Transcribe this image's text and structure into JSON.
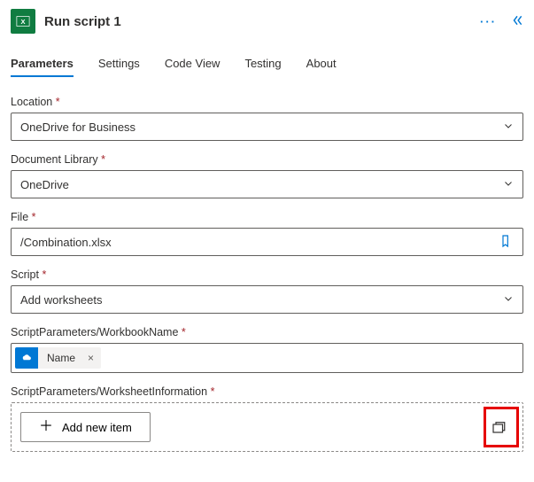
{
  "header": {
    "title": "Run script 1"
  },
  "tabs": [
    {
      "label": "Parameters",
      "active": true
    },
    {
      "label": "Settings"
    },
    {
      "label": "Code View"
    },
    {
      "label": "Testing"
    },
    {
      "label": "About"
    }
  ],
  "fields": {
    "location": {
      "label": "Location",
      "value": "OneDrive for Business"
    },
    "library": {
      "label": "Document Library",
      "value": "OneDrive"
    },
    "file": {
      "label": "File",
      "value": "/Combination.xlsx"
    },
    "script": {
      "label": "Script",
      "value": "Add worksheets"
    },
    "workbook": {
      "label": "ScriptParameters/WorkbookName",
      "token": "Name"
    },
    "worksheet": {
      "label": "ScriptParameters/WorksheetInformation",
      "add_label": "Add new item"
    }
  }
}
